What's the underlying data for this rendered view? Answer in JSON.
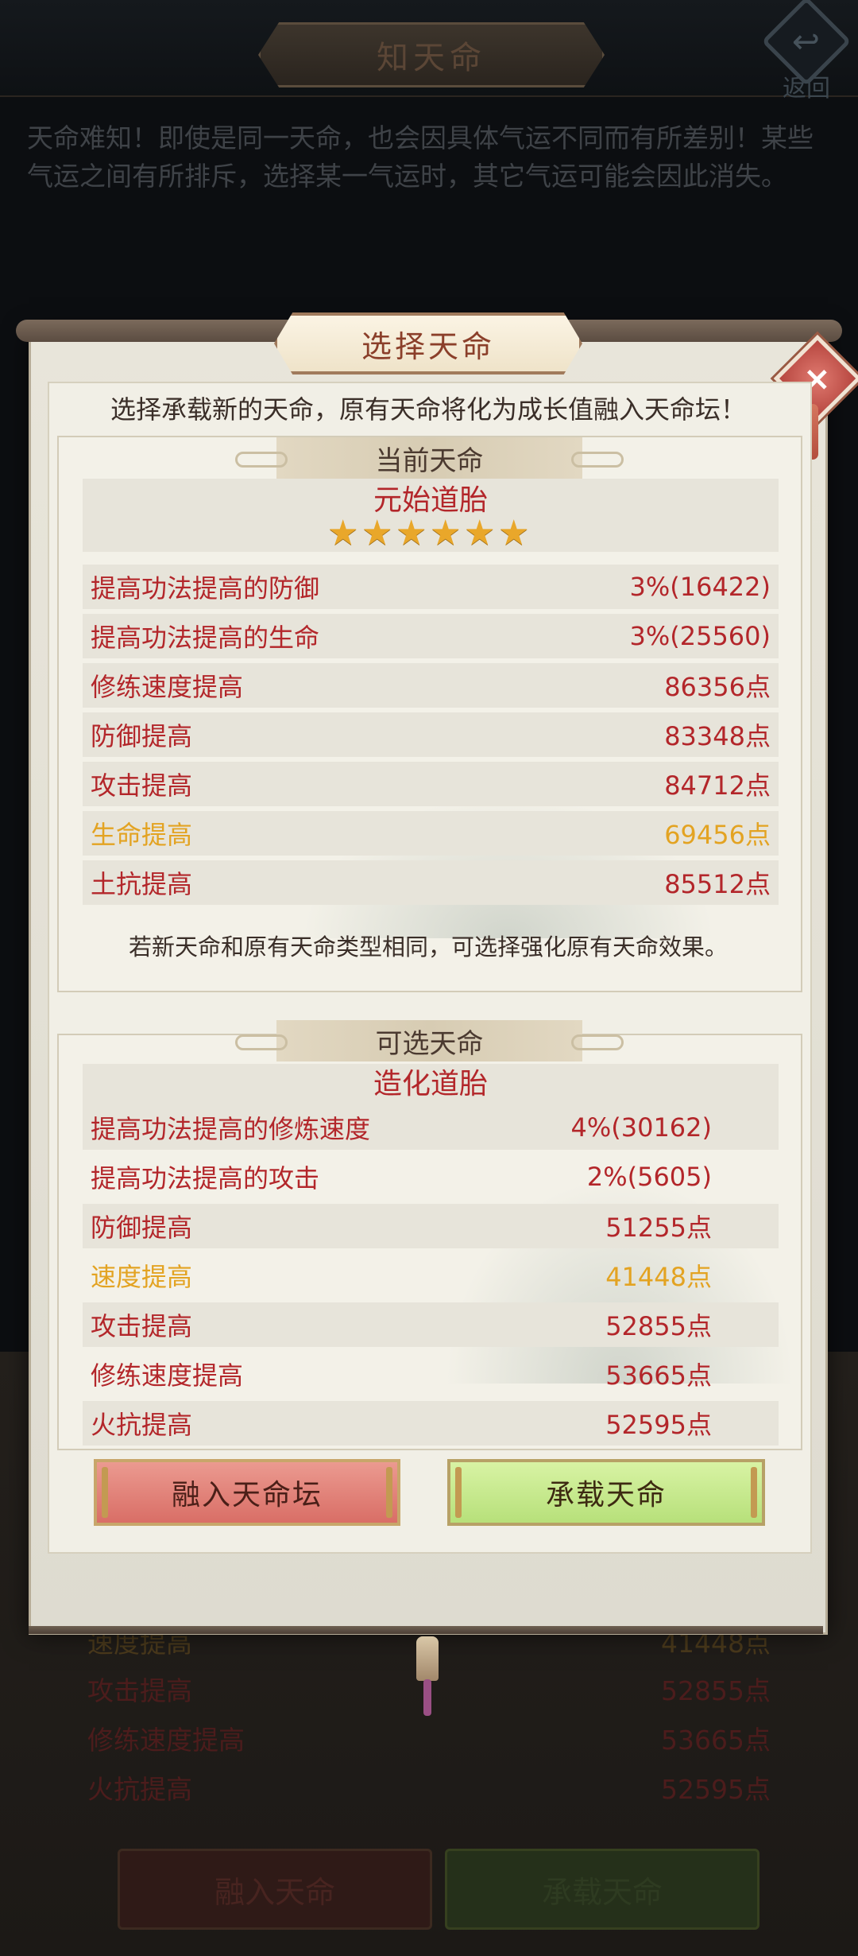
{
  "page": {
    "title": "知天命",
    "back_label": "返回",
    "intro": "天命难知！即使是同一天命，也会因具体气运不同而有所差别！某些气运之间有所排斥，选择某一气运时，其它气运可能会因此消失。"
  },
  "background": {
    "rows": [
      {
        "label": "速度提高",
        "value": "41448点",
        "highlight": true
      },
      {
        "label": "攻击提高",
        "value": "52855点",
        "highlight": false
      },
      {
        "label": "修练速度提高",
        "value": "53665点",
        "highlight": false
      },
      {
        "label": "火抗提高",
        "value": "52595点",
        "highlight": false
      }
    ],
    "buttons": {
      "absorb": "融入天命",
      "carry": "承载天命"
    }
  },
  "modal": {
    "title": "选择天命",
    "subtitle": "选择承载新的天命，原有天命将化为成长值融入天命坛！",
    "current": {
      "header": "当前天命",
      "name": "元始道胎",
      "stars": 6,
      "rows": [
        {
          "label": "提高功法提高的防御",
          "value": "3%(16422)",
          "highlight": false
        },
        {
          "label": "提高功法提高的生命",
          "value": "3%(25560)",
          "highlight": false
        },
        {
          "label": "修练速度提高",
          "value": "86356点",
          "highlight": false
        },
        {
          "label": "防御提高",
          "value": "83348点",
          "highlight": false
        },
        {
          "label": "攻击提高",
          "value": "84712点",
          "highlight": false
        },
        {
          "label": "生命提高",
          "value": "69456点",
          "highlight": true
        },
        {
          "label": "土抗提高",
          "value": "85512点",
          "highlight": false
        }
      ],
      "note": "若新天命和原有天命类型相同，可选择强化原有天命效果。"
    },
    "option": {
      "header": "可选天命",
      "name": "造化道胎",
      "rows": [
        {
          "label": "提高功法提高的修炼速度",
          "value": "4%(30162)",
          "highlight": false
        },
        {
          "label": "提高功法提高的攻击",
          "value": "2%(5605)",
          "highlight": false
        },
        {
          "label": "防御提高",
          "value": "51255点",
          "highlight": false
        },
        {
          "label": "速度提高",
          "value": "41448点",
          "highlight": true
        },
        {
          "label": "攻击提高",
          "value": "52855点",
          "highlight": false
        },
        {
          "label": "修练速度提高",
          "value": "53665点",
          "highlight": false
        },
        {
          "label": "火抗提高",
          "value": "52595点",
          "highlight": false
        }
      ]
    },
    "buttons": {
      "absorb": "融入天命坛",
      "carry": "承载天命"
    },
    "close_icon": "close-icon"
  },
  "colors": {
    "accent_red": "#b3262a",
    "highlight_gold": "#e3a322",
    "button_red": "#d96e66",
    "button_green": "#b7e07a"
  }
}
